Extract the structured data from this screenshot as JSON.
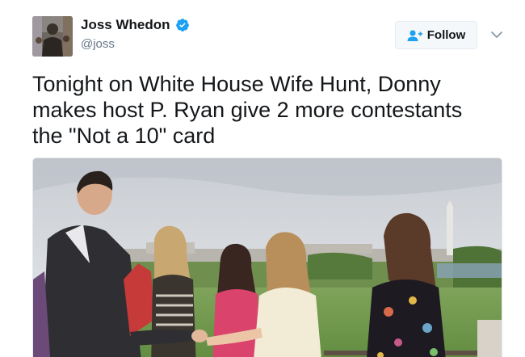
{
  "author": {
    "display_name": "Joss Whedon",
    "handle": "@joss",
    "verified": true,
    "avatar_icon": "profile-photo"
  },
  "actions": {
    "follow_label": "Follow",
    "follow_icon": "add-user-icon",
    "menu_icon": "chevron-down-icon"
  },
  "tweet": {
    "text_lines": [
      "Tonight on White House Wife Hunt, Donny",
      "makes host P. Ryan give 2 more contestants",
      "the \"Not a 10\" card"
    ]
  },
  "media": {
    "kind": "photo"
  },
  "colors": {
    "verified_blue": "#1da1f2",
    "text_primary": "#14171a",
    "text_secondary": "#657786",
    "button_bg": "#f5f8fa",
    "border": "#e6ecf0"
  }
}
